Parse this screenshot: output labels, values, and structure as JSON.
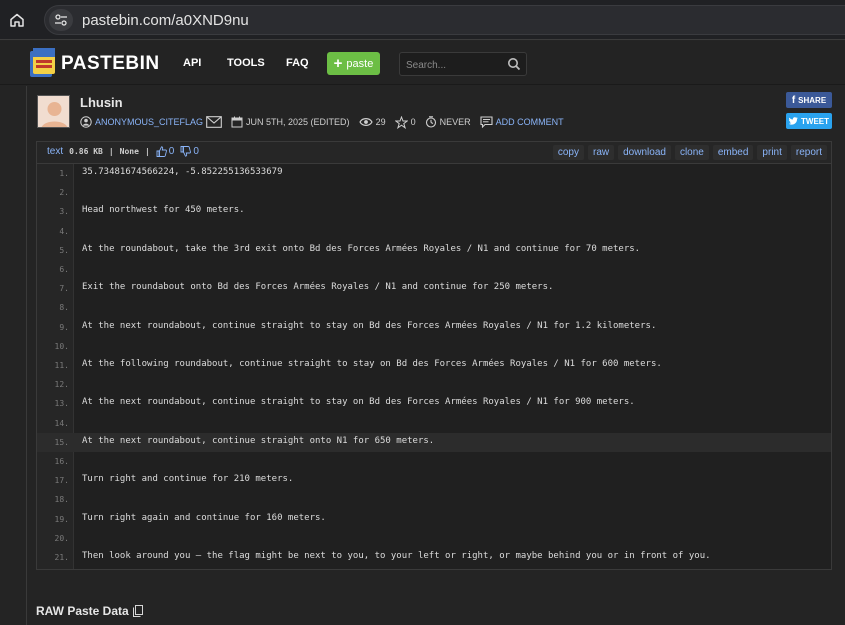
{
  "browser": {
    "url": "pastebin.com/a0XND9nu",
    "home_icon": "home-icon",
    "site_info_icon": "tune-icon"
  },
  "header": {
    "logo_text": "PASTEBIN",
    "nav": [
      "API",
      "TOOLS",
      "FAQ"
    ],
    "paste_button": "paste",
    "search_placeholder": "Search..."
  },
  "paste_info": {
    "title": "Lhusin",
    "author": "ANONYMOUS_CITEFLAG",
    "date": "JUN 5TH, 2025 (EDITED)",
    "views": "29",
    "stars": "0",
    "expire": "NEVER",
    "add_comment": "ADD COMMENT",
    "share": "SHARE",
    "tweet": "TWEET"
  },
  "toolbar": {
    "syntax": "text",
    "size": "0.86 KB",
    "category": "None",
    "likes": "0",
    "dislikes": "0",
    "actions": [
      "copy",
      "raw",
      "download",
      "clone",
      "embed",
      "print",
      "report"
    ]
  },
  "code": {
    "highlighted_line": 15,
    "lines": [
      "35.73481674566224, -5.852255136533679",
      "",
      "Head northwest for 450 meters.",
      "",
      "At the roundabout, take the 3rd exit onto Bd des Forces Armées Royales / N1 and continue for 70 meters.",
      "",
      "Exit the roundabout onto Bd des Forces Armées Royales / N1 and continue for 250 meters.",
      "",
      "At the next roundabout, continue straight to stay on Bd des Forces Armées Royales / N1 for 1.2 kilometers.",
      "",
      "At the following roundabout, continue straight to stay on Bd des Forces Armées Royales / N1 for 600 meters.",
      "",
      "At the next roundabout, continue straight to stay on Bd des Forces Armées Royales / N1 for 900 meters.",
      "",
      "At the next roundabout, continue straight onto N1 for 650 meters.",
      "",
      "Turn right and continue for 210 meters.",
      "",
      "Turn right again and continue for 160 meters.",
      "",
      "Then look around you — the flag might be next to you, to your left or right, or maybe behind you or in front of you."
    ]
  },
  "raw": {
    "title": "RAW Paste Data"
  },
  "colors": {
    "accent_link": "#8ab4f8",
    "paste_button": "#6cbe45",
    "facebook": "#3b5998",
    "twitter": "#2aa3ef"
  }
}
